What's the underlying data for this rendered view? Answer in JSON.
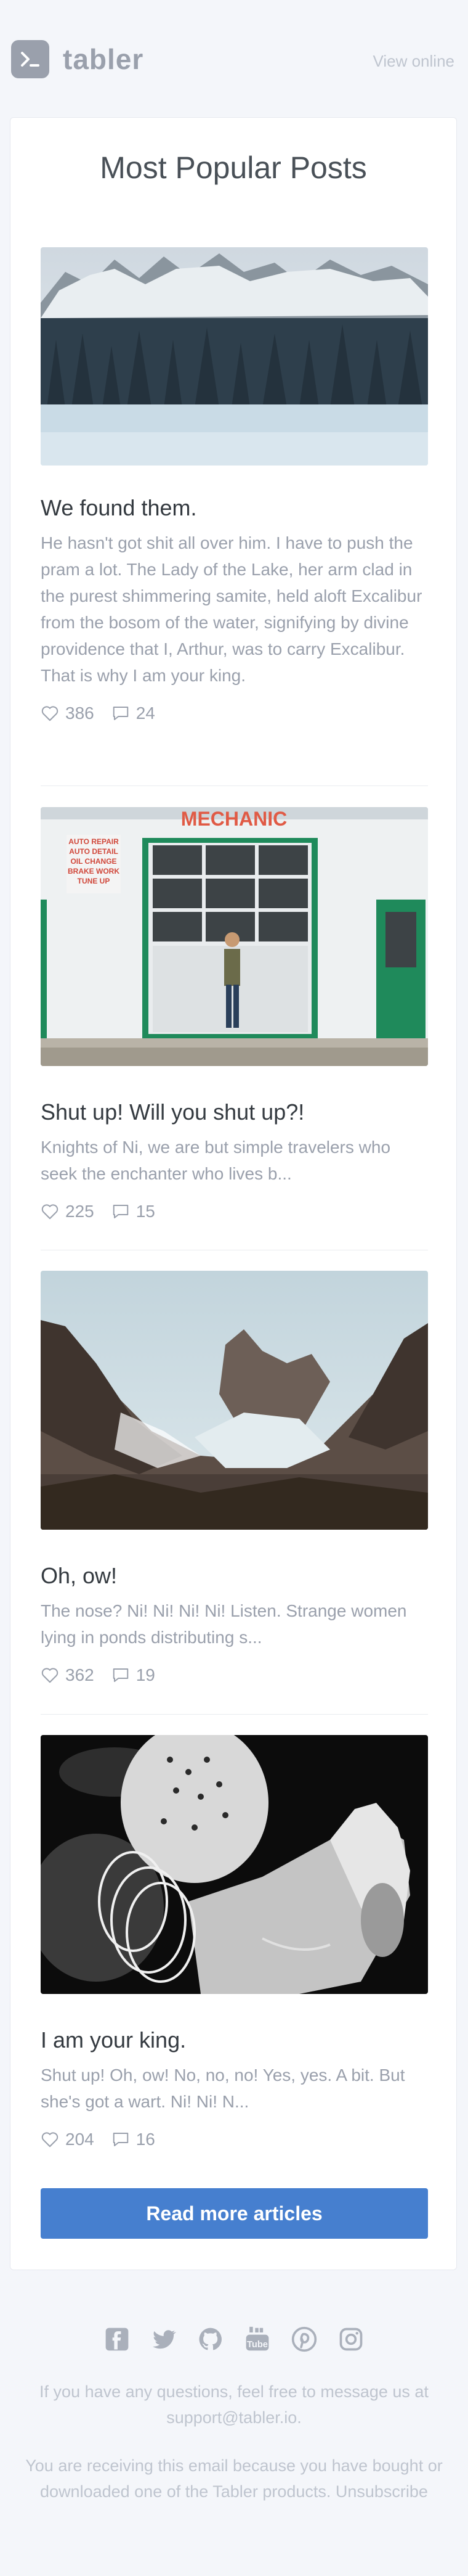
{
  "header": {
    "logo_text": "tabler",
    "view_online": "View online"
  },
  "main": {
    "title": "Most Popular Posts",
    "posts": [
      {
        "title": "We found them.",
        "text": "He hasn't got shit all over him. I have to push the pram a lot. The Lady of the Lake, her arm clad in the purest shimmering samite, held aloft Excalibur from the bosom of the water, signifying by divine providence that I, Arthur, was to carry Excalibur. That is why I am your king.",
        "likes": "386",
        "comments": "24"
      },
      {
        "title": "Shut up! Will you shut up?!",
        "text": "Knights of Ni, we are but simple travelers who seek the enchanter who lives b...",
        "likes": "225",
        "comments": "15",
        "sign": "MECHANIC",
        "window_sign": [
          "AUTO REPAIR",
          "AUTO DETAIL",
          "OIL CHANGE",
          "BRAKE WORK",
          "TUNE UP"
        ]
      },
      {
        "title": "Oh, ow!",
        "text": "The nose? Ni! Ni! Ni! Ni! Listen. Strange women lying in ponds distributing s...",
        "likes": "362",
        "comments": "19"
      },
      {
        "title": "I am your king.",
        "text": "Shut up! Oh, ow! No, no, no! Yes, yes. A bit. But she's got a wart. Ni! Ni! N...",
        "likes": "204",
        "comments": "16"
      }
    ],
    "read_more": "Read more articles"
  },
  "footer": {
    "social_icons": [
      "facebook-icon",
      "twitter-icon",
      "github-icon",
      "youtube-icon",
      "pinterest-icon",
      "instagram-icon"
    ],
    "contact": "If you have any questions, feel free to message us at support@tabler.io.",
    "notice": "You are receiving this email because you have bought or downloaded one of the Tabler products. Unsubscribe"
  },
  "colors": {
    "background": "#f4f6fa",
    "card": "#ffffff",
    "primary": "#467fcf",
    "muted": "#9aa0ac"
  }
}
